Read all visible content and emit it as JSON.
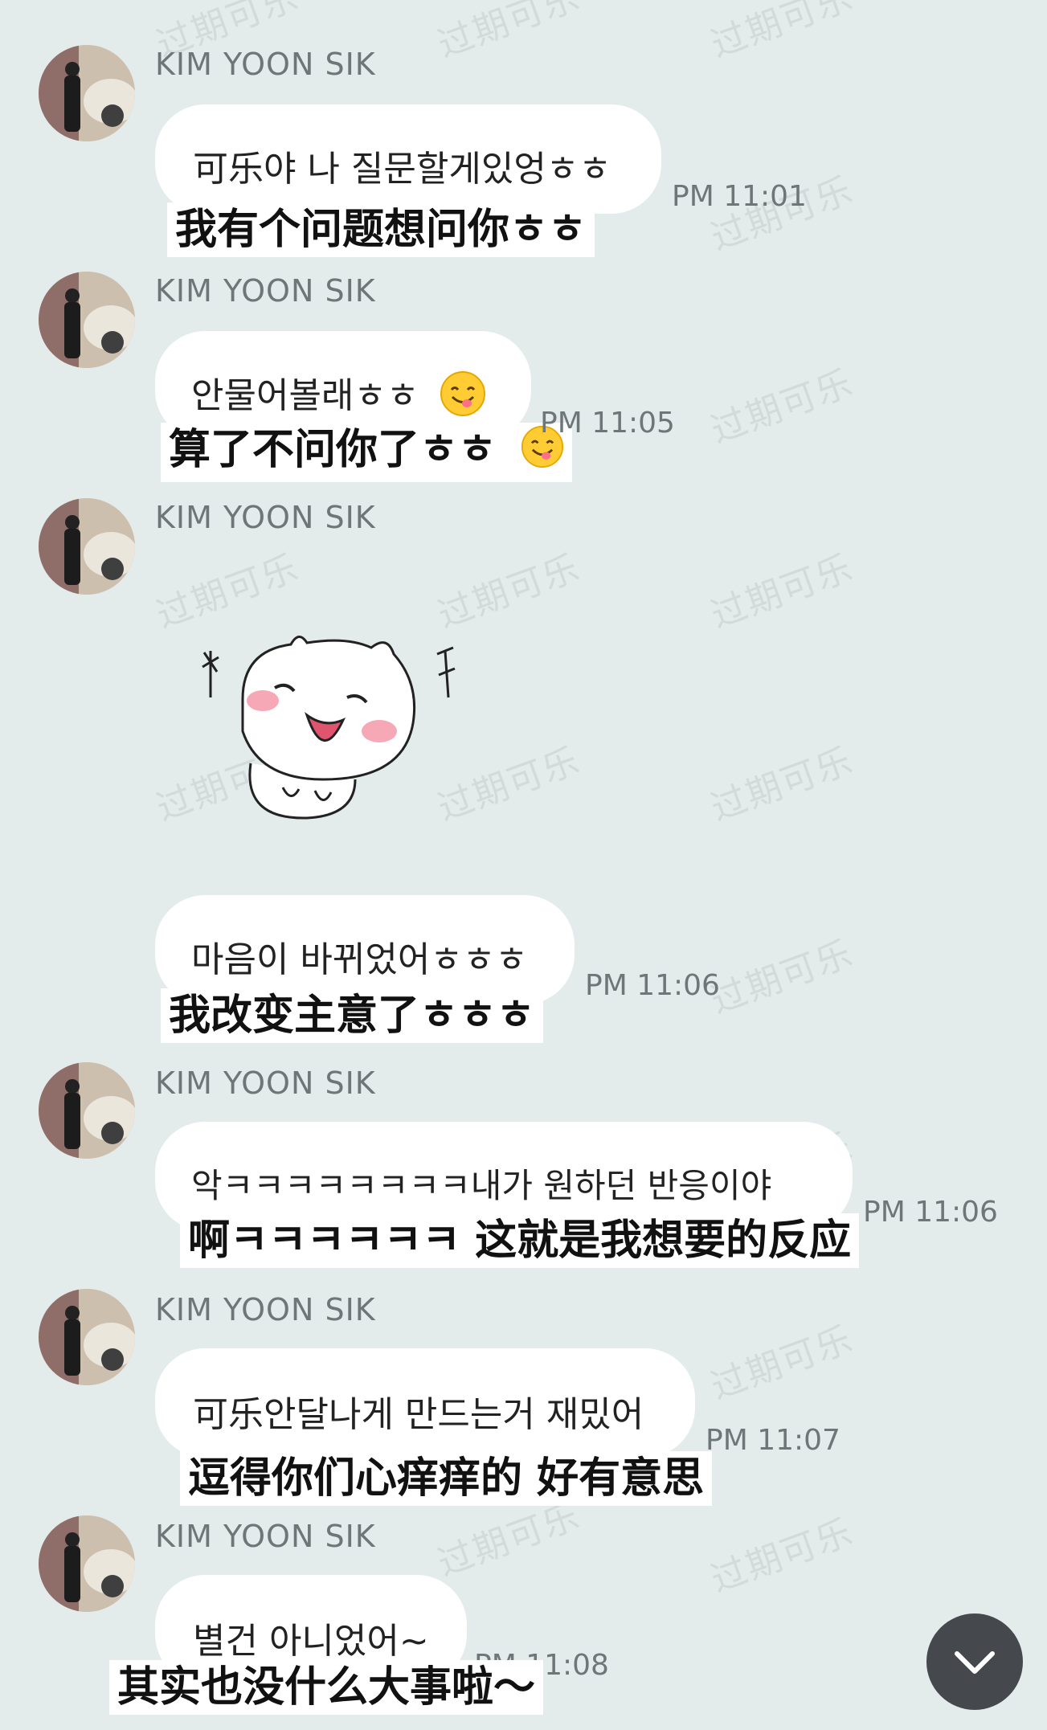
{
  "watermark": "过期可乐",
  "messages": [
    {
      "sender": "KIM YOON SIK",
      "korean": "可乐야 나 질문할게있엉ㅎㅎ",
      "chinese": "我有个问题想问你ㅎㅎ",
      "time": "PM 11:01"
    },
    {
      "sender": "KIM YOON SIK",
      "korean": "안물어볼래ㅎㅎ",
      "chinese": "算了不问你了ㅎㅎ",
      "time": "PM 11:05",
      "emoji": "yum-emoji"
    },
    {
      "sender": "KIM YOON SIK",
      "sticker": "happy-bunny-sticker",
      "korean": "마음이 바뀌었어ㅎㅎㅎ",
      "chinese": "我改变主意了ㅎㅎㅎ",
      "time": "PM 11:06"
    },
    {
      "sender": "KIM YOON SIK",
      "korean": "악ㅋㅋㅋㅋㅋㅋㅋㅋ내가 원하던 반응이야",
      "chinese": "啊ㅋㅋㅋㅋㅋㅋ 这就是我想要的反应",
      "time": "PM 11:06"
    },
    {
      "sender": "KIM YOON SIK",
      "korean": "可乐안달나게 만드는거 재밌어",
      "chinese": "逗得你们心痒痒的 好有意思",
      "time": "PM 11:07"
    },
    {
      "sender": "KIM YOON SIK",
      "korean": "별건 아니었어~",
      "chinese": "其实也没什么大事啦～",
      "time": "PM 11:08"
    }
  ],
  "scroll_button": {
    "icon": "chevron-down-icon"
  },
  "colors": {
    "background": "#e3ebeb",
    "bubble": "#ffffff",
    "meta_text": "#6e7777"
  }
}
